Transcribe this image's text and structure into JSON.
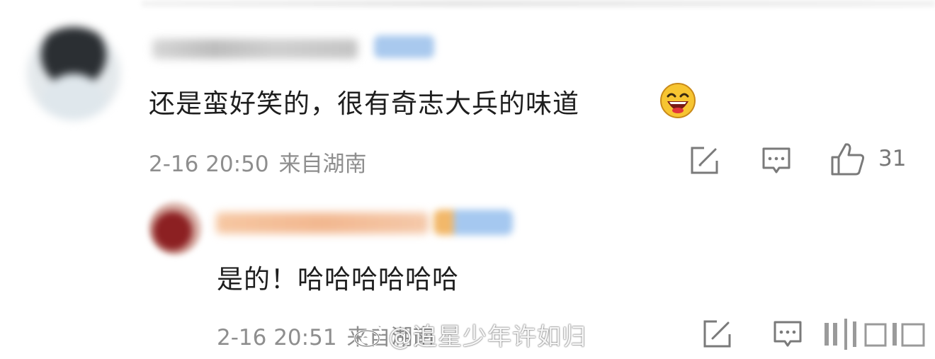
{
  "comment": {
    "text": "还是蛮好笑的，很有奇志大兵的味道",
    "emoji": "laughing-emoji",
    "time": "2-16 20:50",
    "location": "来自湖南",
    "likes": "31"
  },
  "reply": {
    "text": "是的！哈哈哈哈哈哈",
    "time": "2-16 20:51",
    "location": "来自湖南"
  },
  "watermark": {
    "text": "@追星少年许如归"
  },
  "icons": {
    "repost": "repost-icon",
    "comment": "comment-icon",
    "like": "thumbs-up-icon"
  },
  "colors": {
    "meta_gray": "#8e8e8e",
    "text": "#1e1e1e",
    "icon_gray": "#7a7a7a"
  }
}
